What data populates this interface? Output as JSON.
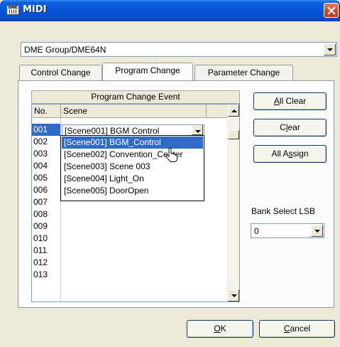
{
  "window": {
    "title": "MIDI",
    "icon_text": "DME"
  },
  "device_select": {
    "value": "DME Group/DME64N"
  },
  "tabs": [
    {
      "label": "Control Change",
      "active": false
    },
    {
      "label": "Program Change",
      "active": true
    },
    {
      "label": "Parameter Change",
      "active": false
    }
  ],
  "program_change": {
    "group_title": "Program Change Event",
    "columns": {
      "no": "No.",
      "scene": "Scene"
    },
    "rows": [
      "001",
      "002",
      "003",
      "004",
      "005",
      "006",
      "007",
      "008",
      "009",
      "010",
      "011",
      "012",
      "013"
    ],
    "selected_row": "001",
    "row_scene_value": "[Scene001] BGM Control",
    "dropdown_options": [
      "[Scene001] BGM_Control",
      "[Scene002] Convention_Center",
      "[Scene003] Scene 003",
      "[Scene004] Light_On",
      "[Scene005] DoorOpen"
    ],
    "highlighted_option": "[Scene001] BGM_Control"
  },
  "side_buttons": {
    "all_clear": {
      "pre": "",
      "u": "A",
      "post": "ll Clear"
    },
    "clear": {
      "pre": "C",
      "u": "l",
      "post": "ear"
    },
    "all_assign": {
      "pre": "All A",
      "u": "s",
      "post": "sign"
    }
  },
  "bank_select": {
    "label": "Bank Select LSB",
    "value": "0"
  },
  "footer": {
    "ok": {
      "u": "O",
      "post": "K"
    },
    "cancel": {
      "u": "C",
      "post": "ancel"
    }
  },
  "colors": {
    "selection": "#316ac5",
    "titlebar": "#0653d6",
    "close": "#d4411e"
  }
}
